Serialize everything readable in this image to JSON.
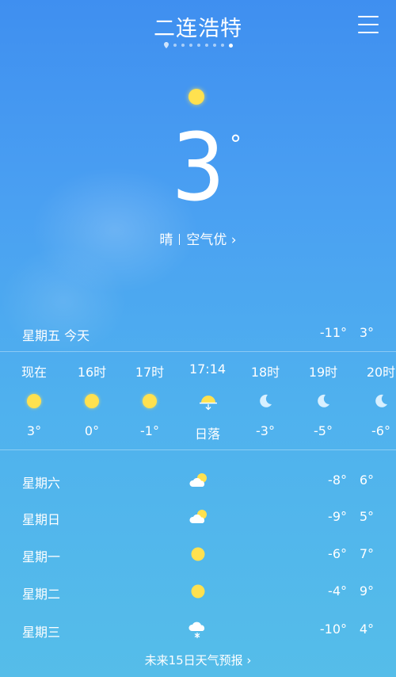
{
  "header": {
    "city": "二连浩特",
    "page_count": 9,
    "active_page": 8
  },
  "current": {
    "temp": "3",
    "deg": "°",
    "condition": "晴",
    "air": "空气优 ›"
  },
  "today": {
    "label": "星期五  今天",
    "low": "-11°",
    "high": "3°"
  },
  "hourly": [
    {
      "time": "现在",
      "icon": "sun-icon",
      "value": "3°"
    },
    {
      "time": "16时",
      "icon": "sun-icon",
      "value": "0°"
    },
    {
      "time": "17时",
      "icon": "sun-icon",
      "value": "-1°"
    },
    {
      "time": "17:14",
      "icon": "sunset-icon",
      "value": "日落"
    },
    {
      "time": "18时",
      "icon": "moon-icon",
      "value": "-3°"
    },
    {
      "time": "19时",
      "icon": "moon-icon",
      "value": "-5°"
    },
    {
      "time": "20时",
      "icon": "moon-icon",
      "value": "-6°"
    }
  ],
  "daily": [
    {
      "name": "星期六",
      "icon": "partly-cloudy-icon",
      "low": "-8°",
      "high": "6°"
    },
    {
      "name": "星期日",
      "icon": "partly-cloudy-icon",
      "low": "-9°",
      "high": "5°"
    },
    {
      "name": "星期一",
      "icon": "sun-icon",
      "low": "-6°",
      "high": "7°"
    },
    {
      "name": "星期二",
      "icon": "sun-icon",
      "low": "-4°",
      "high": "9°"
    },
    {
      "name": "星期三",
      "icon": "snow-icon",
      "low": "-10°",
      "high": "4°"
    }
  ],
  "footer": {
    "label": "未来15日天气预报 ›"
  },
  "colors": {
    "sun": "#ffe14f",
    "moon": "#d8f0ff"
  }
}
